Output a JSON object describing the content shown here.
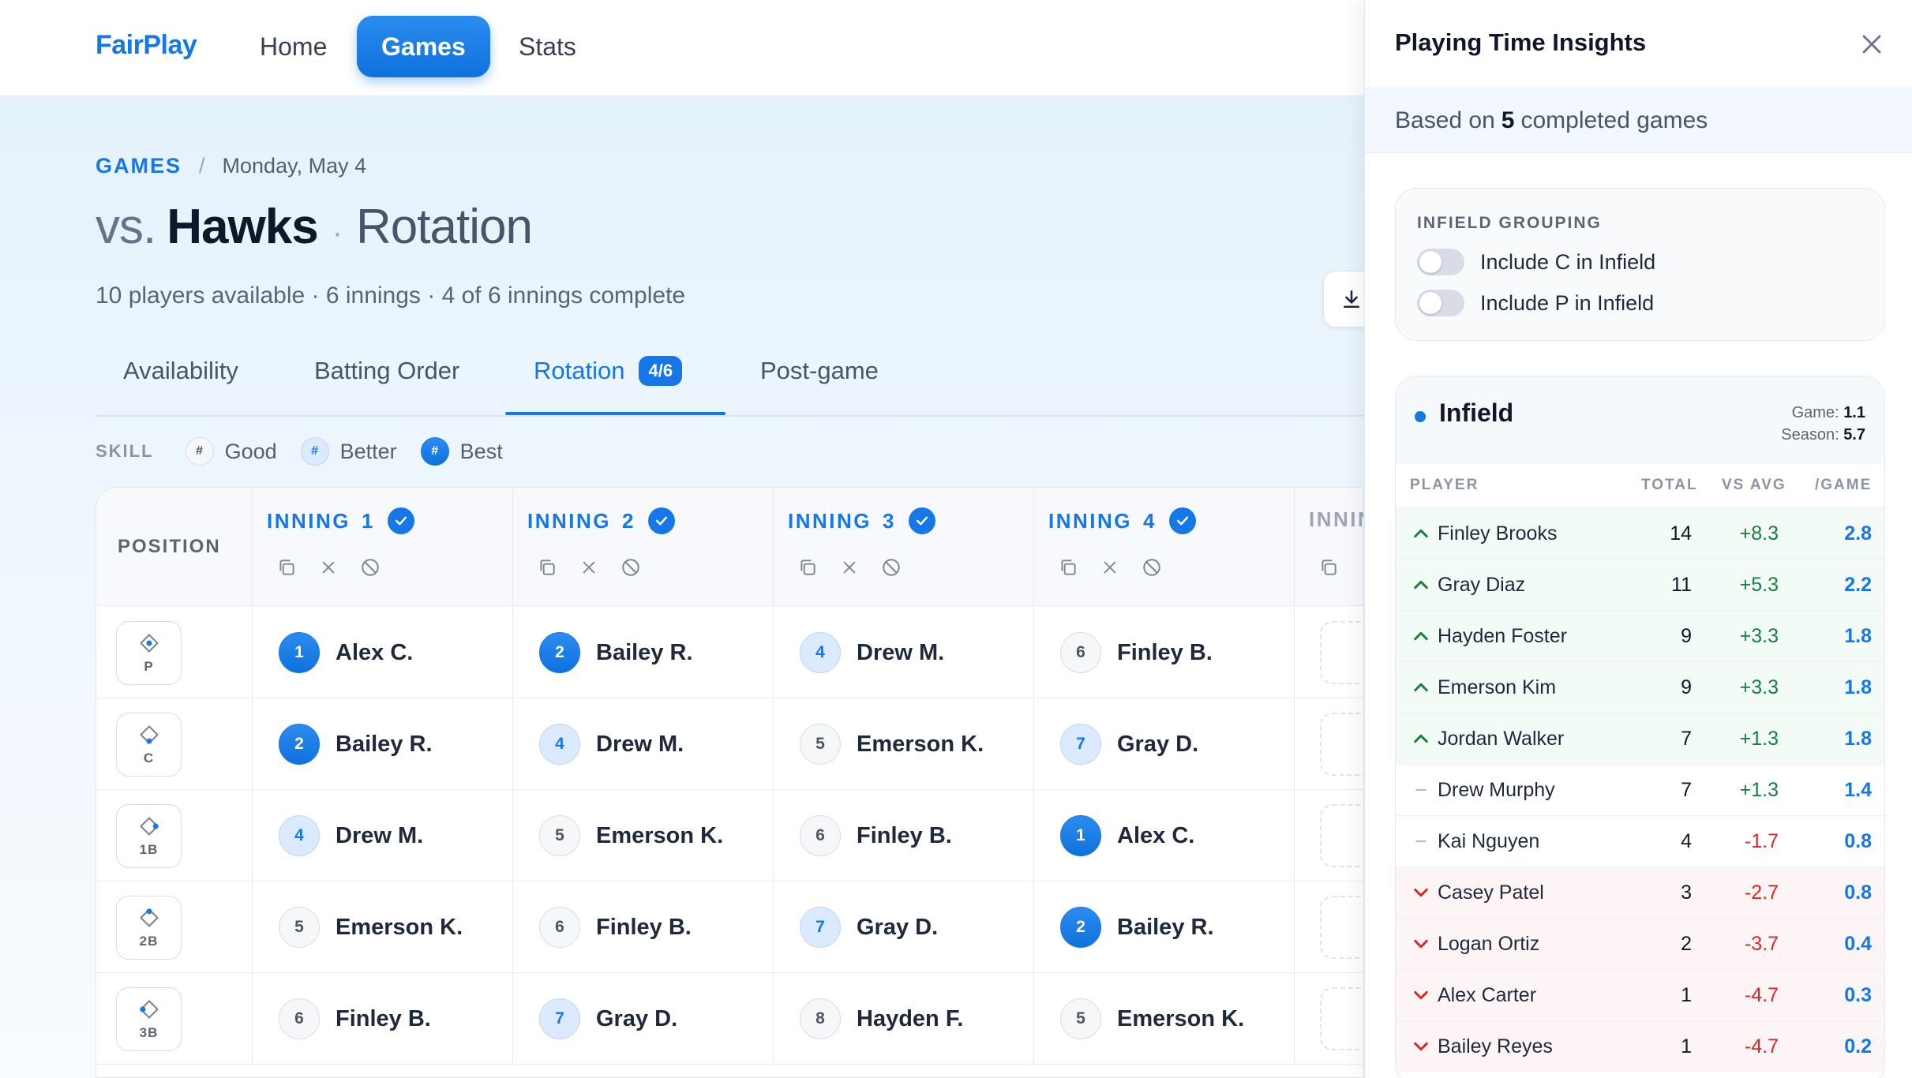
{
  "brand": "FairPlay",
  "nav": {
    "home": "Home",
    "games": "Games",
    "stats": "Stats"
  },
  "breadcrumb": {
    "root": "GAMES",
    "sep": "/",
    "current": "Monday, May 4"
  },
  "title": {
    "vs": "vs.",
    "team": "Hawks",
    "dot": "·",
    "section": "Rotation"
  },
  "subtitle": "10 players available · 6 innings · 4 of 6 innings complete",
  "tabs": {
    "availability": "Availability",
    "batting_order": "Batting Order",
    "rotation": "Rotation",
    "rotation_badge": "4/6",
    "post_game": "Post-game"
  },
  "legend": {
    "label": "SKILL",
    "good": "Good",
    "better": "Better",
    "best": "Best",
    "glyph": "#"
  },
  "grid": {
    "position_header": "POSITION",
    "inning_label": "INNING",
    "inning_label_partial": "INNIN",
    "innings": [
      "1",
      "2",
      "3",
      "4"
    ],
    "positions": [
      "P",
      "C",
      "1B",
      "2B",
      "3B"
    ],
    "rows": [
      [
        {
          "num": "1",
          "name": "Alex C.",
          "skill": "best"
        },
        {
          "num": "2",
          "name": "Bailey R.",
          "skill": "best"
        },
        {
          "num": "4",
          "name": "Drew M.",
          "skill": "better"
        },
        {
          "num": "6",
          "name": "Finley B.",
          "skill": "good"
        }
      ],
      [
        {
          "num": "2",
          "name": "Bailey R.",
          "skill": "best"
        },
        {
          "num": "4",
          "name": "Drew M.",
          "skill": "better"
        },
        {
          "num": "5",
          "name": "Emerson K.",
          "skill": "good"
        },
        {
          "num": "7",
          "name": "Gray D.",
          "skill": "better"
        }
      ],
      [
        {
          "num": "4",
          "name": "Drew M.",
          "skill": "better"
        },
        {
          "num": "5",
          "name": "Emerson K.",
          "skill": "good"
        },
        {
          "num": "6",
          "name": "Finley B.",
          "skill": "good"
        },
        {
          "num": "1",
          "name": "Alex C.",
          "skill": "best"
        }
      ],
      [
        {
          "num": "5",
          "name": "Emerson K.",
          "skill": "good"
        },
        {
          "num": "6",
          "name": "Finley B.",
          "skill": "good"
        },
        {
          "num": "7",
          "name": "Gray D.",
          "skill": "better"
        },
        {
          "num": "2",
          "name": "Bailey R.",
          "skill": "best"
        }
      ],
      [
        {
          "num": "6",
          "name": "Finley B.",
          "skill": "good"
        },
        {
          "num": "7",
          "name": "Gray D.",
          "skill": "better"
        },
        {
          "num": "8",
          "name": "Hayden F.",
          "skill": "good"
        },
        {
          "num": "5",
          "name": "Emerson K.",
          "skill": "good"
        }
      ]
    ]
  },
  "panel": {
    "title": "Playing Time Insights",
    "sub_prefix": "Based on",
    "games_count": "5",
    "sub_suffix": "completed games",
    "grouping": {
      "label": "INFIELD GROUPING",
      "toggle_c": "Include C in Infield",
      "toggle_p": "Include P in Infield"
    },
    "infield": {
      "title": "Infield",
      "game_label": "Game:",
      "game_avg": "1.1",
      "season_label": "Season:",
      "season_avg": "5.7",
      "columns": {
        "player": "PLAYER",
        "total": "TOTAL",
        "vs_avg": "VS AVG",
        "per_game": "/GAME"
      },
      "players": [
        {
          "trend": "up",
          "name": "Finley Brooks",
          "total": "14",
          "vs_avg": "+8.3",
          "per_game": "2.8"
        },
        {
          "trend": "up",
          "name": "Gray Diaz",
          "total": "11",
          "vs_avg": "+5.3",
          "per_game": "2.2"
        },
        {
          "trend": "up",
          "name": "Hayden Foster",
          "total": "9",
          "vs_avg": "+3.3",
          "per_game": "1.8"
        },
        {
          "trend": "up",
          "name": "Emerson Kim",
          "total": "9",
          "vs_avg": "+3.3",
          "per_game": "1.8"
        },
        {
          "trend": "up",
          "name": "Jordan Walker",
          "total": "7",
          "vs_avg": "+1.3",
          "per_game": "1.8"
        },
        {
          "trend": "flat",
          "name": "Drew Murphy",
          "total": "7",
          "vs_avg": "+1.3",
          "per_game": "1.4"
        },
        {
          "trend": "flat",
          "name": "Kai Nguyen",
          "total": "4",
          "vs_avg": "-1.7",
          "per_game": "0.8"
        },
        {
          "trend": "down",
          "name": "Casey Patel",
          "total": "3",
          "vs_avg": "-2.7",
          "per_game": "0.8"
        },
        {
          "trend": "down",
          "name": "Logan Ortiz",
          "total": "2",
          "vs_avg": "-3.7",
          "per_game": "0.4"
        },
        {
          "trend": "down",
          "name": "Alex Carter",
          "total": "1",
          "vs_avg": "-4.7",
          "per_game": "0.3"
        },
        {
          "trend": "down",
          "name": "Bailey Reyes",
          "total": "1",
          "vs_avg": "-4.7",
          "per_game": "0.2"
        }
      ]
    }
  },
  "colors": {
    "accent": "#1677e8",
    "positive": "#16803c",
    "negative": "#dc2626"
  }
}
